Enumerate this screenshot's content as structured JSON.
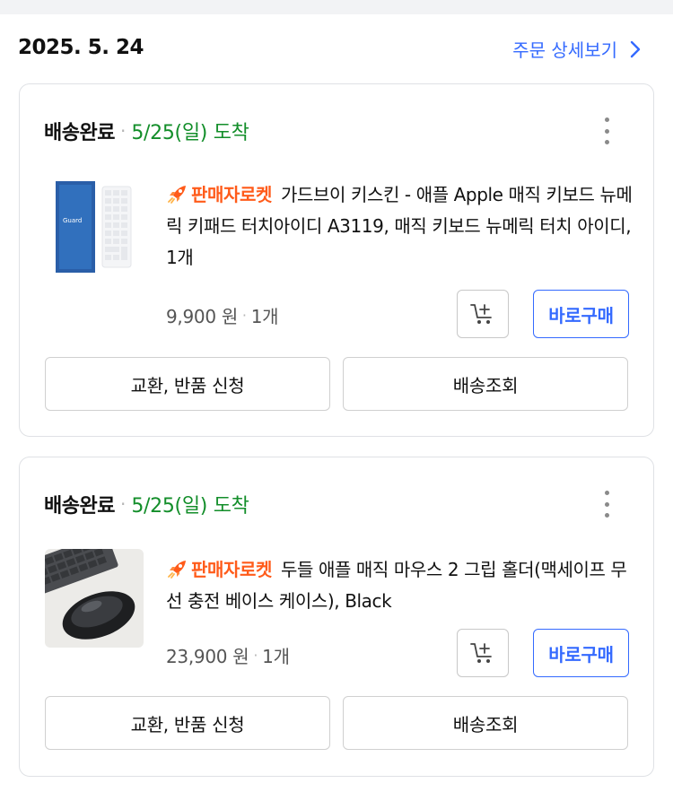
{
  "order": {
    "date": "2025. 5. 24",
    "detail_link": "주문 상세보기",
    "detail_icon": "chevron-right-icon",
    "link_color": "#346aff"
  },
  "items": [
    {
      "status": "배송완료",
      "arrival": "5/25(일) 도착",
      "badge": "판매자로켓",
      "name": "가드브이 키스킨 - 애플 Apple 매직 키보드 뉴메릭 키패드 터치아이디 A3119, 매직 키보드 뉴메릭 터치 아이디, 1개",
      "price": "9,900 원",
      "qty": "1개",
      "thumb_logo": "Guard",
      "buy_label": "바로구매",
      "exchange_label": "교환, 반품 신청",
      "tracking_label": "배송조회"
    },
    {
      "status": "배송완료",
      "arrival": "5/25(일) 도착",
      "badge": "판매자로켓",
      "name": "두들 애플 매직 마우스 2 그립 홀더(맥세이프 무선 충전 베이스 케이스), Black",
      "price": "23,900 원",
      "qty": "1개",
      "buy_label": "바로구매",
      "exchange_label": "교환, 반품 신청",
      "tracking_label": "배송조회"
    }
  ],
  "colors": {
    "arrival_green": "#138e2a",
    "rocket_orange": "#ff5b1a",
    "accent_blue": "#346aff"
  },
  "icons": [
    "rocket-icon",
    "add-to-cart-icon",
    "more-vertical-icon",
    "chevron-right-icon"
  ]
}
